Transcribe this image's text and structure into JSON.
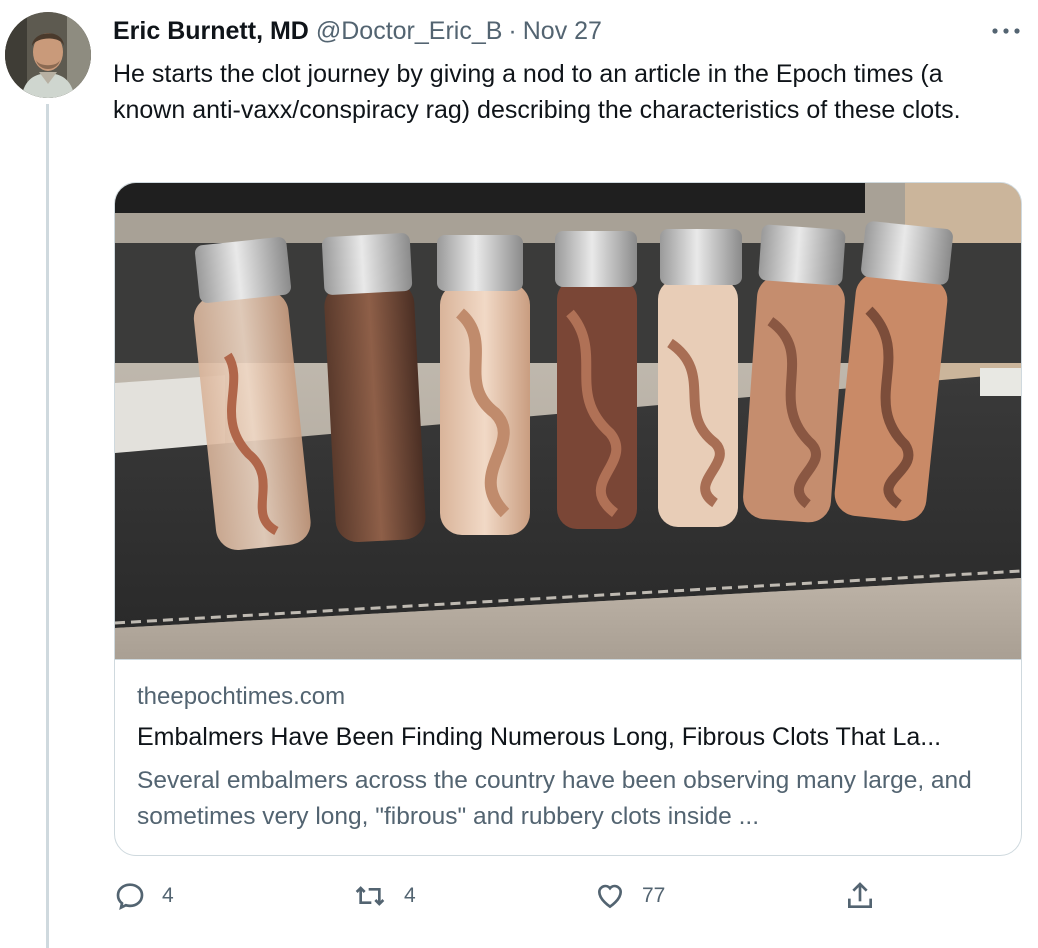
{
  "tweet": {
    "author_name": "Eric Burnett, MD",
    "handle": "@Doctor_Eric_B",
    "separator": "·",
    "date": "Nov 27",
    "text": "He starts the clot journey by giving a nod to an article in the Epoch times (a known anti-vaxx/conspiracy rag) describing the characteristics of these clots."
  },
  "card": {
    "domain": "theepochtimes.com",
    "title": "Embalmers Have Been Finding Numerous Long, Fibrous Clots That La...",
    "description": "Several embalmers across the country have been observing many large, and sometimes very long, \"fibrous\" and rubbery clots inside ..."
  },
  "actions": {
    "reply_count": "4",
    "retweet_count": "4",
    "like_count": "77"
  },
  "icons": {
    "more": "more-icon",
    "reply": "reply-icon",
    "retweet": "retweet-icon",
    "like": "heart-icon",
    "share": "share-icon"
  },
  "colors": {
    "text": "#0f1419",
    "secondary": "#536471",
    "border": "#cfd9de"
  }
}
